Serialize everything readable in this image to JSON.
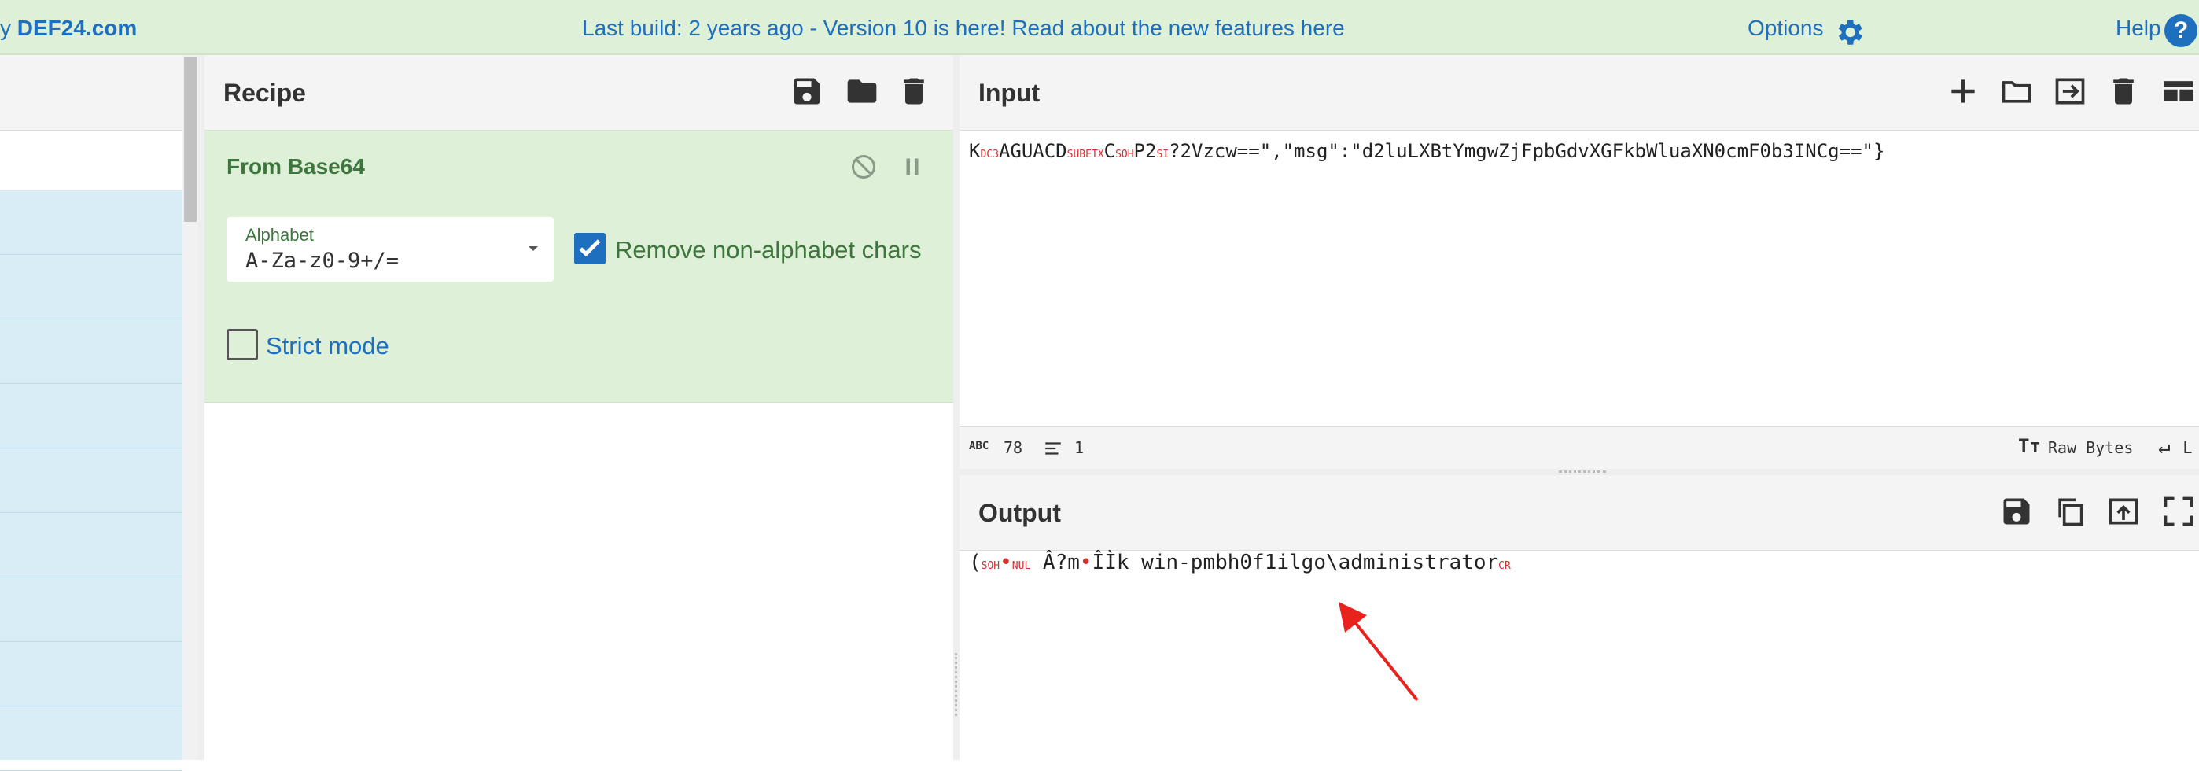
{
  "topbar": {
    "brand_prefix": "y ",
    "brand": "DEF24.com",
    "banner": "Last build: 2 years ago - Version 10 is here! Read about the new features here",
    "options": "Options",
    "help": "Help",
    "help_glyph": "?"
  },
  "recipe": {
    "title": "Recipe",
    "operation": {
      "title": "From Base64",
      "alphabet_label": "Alphabet",
      "alphabet_value": "A-Za-z0-9+/=",
      "remove_non_alphabet_label": "Remove non-alphabet chars",
      "remove_non_alphabet_checked": true,
      "strict_mode_label": "Strict mode",
      "strict_mode_checked": false
    }
  },
  "input": {
    "title": "Input",
    "segments": [
      {
        "text": "K"
      },
      {
        "ctl": "DC3"
      },
      {
        "text": "AGUACD"
      },
      {
        "ctl": "SUBETX"
      },
      {
        "text": "C"
      },
      {
        "ctl": "SOH"
      },
      {
        "text": "P2"
      },
      {
        "ctl": "SI"
      },
      {
        "text": "?2Vzcw==\",\"msg\":\"d2luLXBtYmgwZjFpbGdvXGFkbWluaXN0cmF0b3INCg==\"}"
      }
    ],
    "status": {
      "abc": "ABC",
      "chars": "78",
      "lines": "1",
      "tt": "Tт",
      "encoding": "Raw Bytes",
      "eol_glyph": "↵",
      "eol": "L"
    }
  },
  "output": {
    "title": "Output",
    "segments": [
      {
        "text": "("
      },
      {
        "ctl": "SOH"
      },
      {
        "dot": "•"
      },
      {
        "ctl": "NUL"
      },
      {
        "text": " Â?m"
      },
      {
        "dot": "•"
      },
      {
        "text": "ÎÌk win-pmbh0f1ilgo\\administrator"
      },
      {
        "ctl": "CR"
      }
    ]
  },
  "colors": {
    "accent": "#1f6fbf",
    "op_green_bg": "#dff0d8",
    "op_green_text": "#3c763d",
    "control_char": "#d62f2f",
    "ops_list_bg": "#d9edf7"
  }
}
